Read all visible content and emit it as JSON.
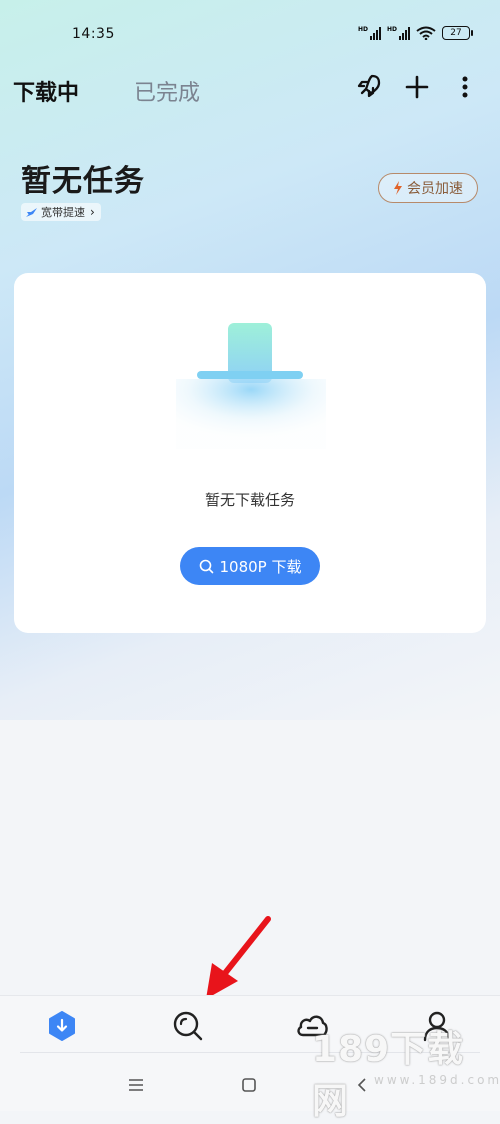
{
  "status_bar": {
    "time": "14:35",
    "battery": "27",
    "hd1": "HD",
    "hd2": "HD"
  },
  "header": {
    "tab_active": "下载中",
    "tab_completed": "已完成",
    "icons": [
      "rocket-icon",
      "plus-icon",
      "more-vertical-icon"
    ]
  },
  "summary": {
    "title": "暂无任务",
    "speed_link": "宽带提速",
    "vip_button": "会员加速"
  },
  "empty_card": {
    "message": "暂无下载任务",
    "download_button": "1080P 下载"
  },
  "bottom_nav": {
    "items": [
      "download-icon",
      "search-icon",
      "cloud-icon",
      "profile-icon"
    ],
    "active": "download-icon"
  },
  "watermark": {
    "text": "189下载网",
    "url": "www.189d.com"
  },
  "colors": {
    "accent": "#3d86f5",
    "vip": "#8a5d3b",
    "annotation": "#e8141b"
  }
}
